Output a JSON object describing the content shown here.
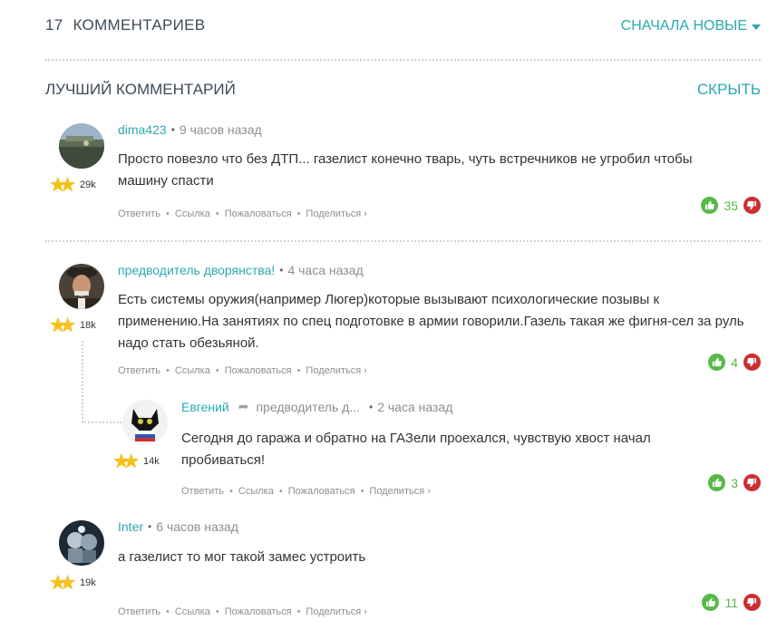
{
  "header": {
    "count": "17",
    "count_label": "КОММЕНТАРИЕВ",
    "sort_label": "СНАЧАЛА НОВЫЕ"
  },
  "best": {
    "title": "ЛУЧШИЙ КОММЕНТАРИЙ",
    "hide_label": "СКРЫТЬ"
  },
  "actions": {
    "reply": "Ответить",
    "link": "Ссылка",
    "report": "Пожаловаться",
    "share": "Поделиться ›"
  },
  "comments": [
    {
      "author": "dima423",
      "time": "9 часов назад",
      "rating": "29k",
      "text": "Просто повезло что без ДТП... газелист конечно тварь, чуть встречников не угробил чтобы машину спасти",
      "votes": "35"
    },
    {
      "author": "предводитель дворянства!",
      "time": "4 часа назад",
      "rating": "18k",
      "text": "Есть системы оружия(например Люгер)которые вызывают психологические позывы к применению.На занятиях по спец подготовке в армии говорили.Газель такая же фигня-сел за руль надо стать обезьяной.",
      "votes": "4"
    },
    {
      "author": "Евгений",
      "reply_to": "предводитель д...",
      "time": "2 часа назад",
      "rating": "14k",
      "text": "Сегодня до гаража и обратно на ГАЗели проехался, чувствую хвост начал пробиваться!",
      "votes": "3"
    },
    {
      "author": "Inter",
      "time": "6 часов назад",
      "rating": "19k",
      "text": "а газелист то мог такой замес устроить",
      "votes": "11"
    }
  ],
  "colors": {
    "accent": "#2aa9b0",
    "vote_up": "#57b947",
    "vote_down": "#cc2e2e",
    "star": "#f5c21b"
  }
}
